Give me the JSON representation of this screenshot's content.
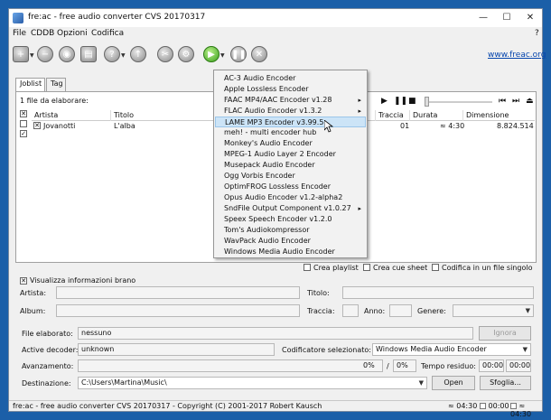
{
  "window": {
    "title": "fre:ac - free audio converter CVS 20170317"
  },
  "menu": [
    "File",
    "CDDB",
    "Opzioni",
    "Codifica"
  ],
  "help_label": "?",
  "website_link": "www.freac.org",
  "tabs": [
    "Joblist",
    "Tag"
  ],
  "joblist": {
    "files_count": "1 file da elaborare:",
    "columns": [
      "Artista",
      "Titolo",
      "Traccia",
      "Durata",
      "Dimensione"
    ],
    "rows": [
      {
        "checked": "✕",
        "artist": "Jovanotti",
        "title": "L'alba",
        "track": "01",
        "duration": "≈ 4:30",
        "size": "8.824.514"
      }
    ],
    "select_marks": [
      "✕",
      "",
      "✓"
    ]
  },
  "encoder_menu": {
    "items": [
      {
        "label": "AC-3 Audio Encoder",
        "submenu": ""
      },
      {
        "label": "Apple Lossless Encoder",
        "submenu": ""
      },
      {
        "label": "FAAC MP4/AAC Encoder v1.28",
        "submenu": "▸"
      },
      {
        "label": "FLAC Audio Encoder v1.3.2",
        "submenu": "▸"
      },
      {
        "label": "LAME MP3 Encoder v3.99.5",
        "submenu": ""
      },
      {
        "label": "meh! - multi encoder hub",
        "submenu": ""
      },
      {
        "label": "Monkey's Audio Encoder",
        "submenu": ""
      },
      {
        "label": "MPEG-1 Audio Layer 2 Encoder",
        "submenu": ""
      },
      {
        "label": "Musepack Audio Encoder",
        "submenu": ""
      },
      {
        "label": "Ogg Vorbis Encoder",
        "submenu": ""
      },
      {
        "label": "OptimFROG Lossless Encoder",
        "submenu": ""
      },
      {
        "label": "Opus Audio Encoder v1.2-alpha2",
        "submenu": ""
      },
      {
        "label": "SndFile Output Component v1.0.27",
        "submenu": "▸"
      },
      {
        "label": "Speex Speech Encoder v1.2.0",
        "submenu": ""
      },
      {
        "label": "Tom's Audiokompressor",
        "submenu": ""
      },
      {
        "label": "WavPack Audio Encoder",
        "submenu": ""
      },
      {
        "label": "Windows Media Audio Encoder",
        "submenu": ""
      }
    ],
    "selected": "LAME MP3 Encoder v3.99.5"
  },
  "options": {
    "playlist": "Crea playlist",
    "cue": "Crea cue sheet",
    "single_file": "Codifica in un file singolo"
  },
  "info": {
    "show_label": "Visualizza informazioni brano",
    "show_mark": "✕",
    "artist_label": "Artista:",
    "title_label": "Titolo:",
    "album_label": "Album:",
    "track_label": "Traccia:",
    "year_label": "Anno:",
    "genre_label": "Genere:"
  },
  "progress": {
    "file_label": "File elaborato:",
    "file_value": "nessuno",
    "skip_button": "Ignora",
    "decoder_label": "Active decoder:",
    "decoder_value": "unknown",
    "encoder_label": "Codificatore selezionato:",
    "encoder_value": "Windows Media Audio Encoder",
    "progress_label": "Avanzamento:",
    "percent_1": "0%",
    "separator": "/",
    "percent_2": "0%",
    "time_label": "Tempo residuo:",
    "time_1": "00:00",
    "time_2": "00:00",
    "dest_label": "Destinazione:",
    "dest_value": "C:\\Users\\Martina\\Music\\",
    "open_button": "Open",
    "browse_button": "Sfoglia..."
  },
  "statusbar": {
    "text": "fre:ac - free audio converter CVS 20170317 - Copyright (C) 2001-2017 Robert Kausch",
    "time_a": "≈ 04:30",
    "time_b": "00:00",
    "time_c": "≈ 04:30"
  },
  "colors": {
    "desktop": "#1b5fa8",
    "selection": "#cce4f7",
    "link": "#0645ad",
    "play_green": "#3ca11c"
  }
}
